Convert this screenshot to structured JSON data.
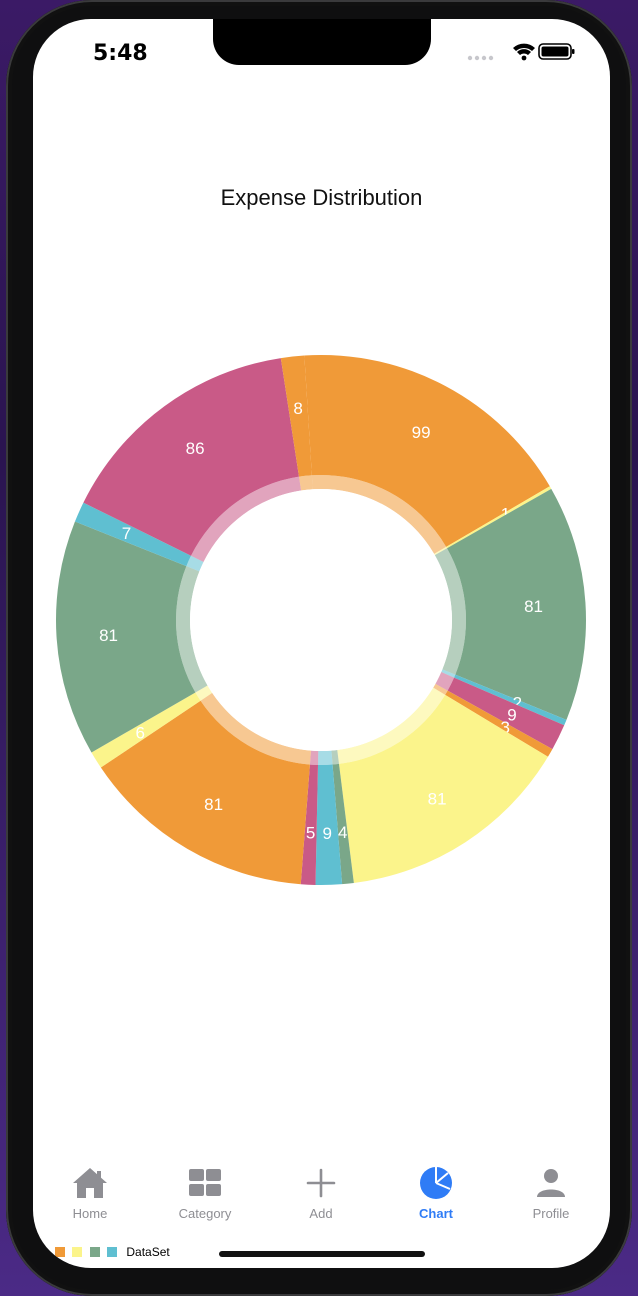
{
  "status": {
    "time": "5:48"
  },
  "chart_data": {
    "type": "pie",
    "title": "Expense Distribution",
    "legend": {
      "position": "bottom-left",
      "label": "DataSet"
    },
    "colors": [
      "#f09a38",
      "#7aa789",
      "#5fbfd1",
      "#c95a87",
      "#fbf48b"
    ],
    "slices": [
      {
        "value": 99,
        "color": "#f09a38"
      },
      {
        "value": 1,
        "color": "#fbf48b"
      },
      {
        "value": 81,
        "color": "#7aa789"
      },
      {
        "value": 2,
        "color": "#5fbfd1"
      },
      {
        "value": 9,
        "color": "#c95a87"
      },
      {
        "value": 3,
        "color": "#f09a38"
      },
      {
        "value": 81,
        "color": "#fbf48b"
      },
      {
        "value": 4,
        "color": "#7aa789"
      },
      {
        "value": 9,
        "color": "#5fbfd1"
      },
      {
        "value": 5,
        "color": "#c95a87"
      },
      {
        "value": 81,
        "color": "#f09a38"
      },
      {
        "value": 6,
        "color": "#fbf48b"
      },
      {
        "value": 81,
        "color": "#7aa789"
      },
      {
        "value": 7,
        "color": "#5fbfd1"
      },
      {
        "value": 86,
        "color": "#c95a87"
      },
      {
        "value": 8,
        "color": "#f09a38"
      }
    ]
  },
  "tabs": [
    {
      "label": "Home",
      "icon": "house-icon",
      "active": false
    },
    {
      "label": "Category",
      "icon": "grid-icon",
      "active": false
    },
    {
      "label": "Add",
      "icon": "plus-icon",
      "active": false
    },
    {
      "label": "Chart",
      "icon": "pie-chart-icon",
      "active": true
    },
    {
      "label": "Profile",
      "icon": "person-icon",
      "active": false
    }
  ]
}
